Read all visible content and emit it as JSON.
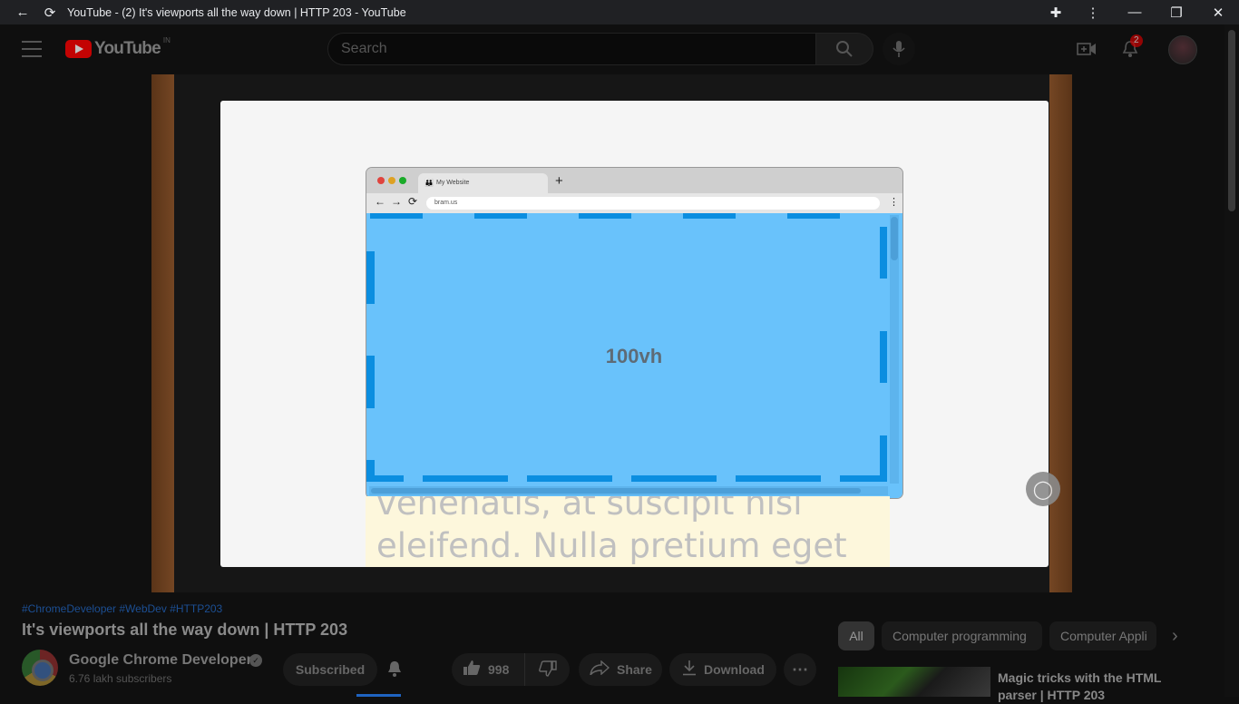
{
  "window": {
    "title": "YouTube - (2) It's viewports all the way down | HTTP 203 - YouTube",
    "back_icon": "←",
    "reload_icon": "⟳",
    "extensions_icon": "✚",
    "menu_icon": "⋮",
    "minimize_icon": "—",
    "restore_icon": "❐",
    "close_icon": "✕"
  },
  "header": {
    "logo_text": "YouTube",
    "logo_country": "IN",
    "search_placeholder": "Search",
    "search_icon": "⌕",
    "mic_icon": "🎙",
    "create_icon": "⊞",
    "notifications_count": "2",
    "bell_icon": "🔔"
  },
  "video": {
    "mock_browser": {
      "tab_label": "My Website",
      "tab_icon": "👪",
      "new_tab": "+",
      "back": "←",
      "forward": "→",
      "reload": "⟳",
      "url": "bram.us",
      "menu": "⋮",
      "viewport_label": "100vh"
    },
    "lorem_line_1": "venenatis, at suscipit nisi",
    "lorem_line_2": "eleifend. Nulla pretium eget",
    "chrome_badge": "◯"
  },
  "info": {
    "hashtags": "#ChromeDeveloper #WebDev #HTTP203",
    "title": "It's viewports all the way down | HTTP 203",
    "channel_name": "Google Chrome Developers",
    "verified_icon": "✓",
    "subscribers": "6.76 lakh subscribers",
    "subscribed_label": "Subscribed",
    "bell_icon": "🔔",
    "like_count": "998",
    "like_icon": "👍",
    "dislike_icon": "👎",
    "share_label": "Share",
    "share_icon": "➦",
    "download_label": "Download",
    "download_icon": "⤓",
    "more_icon": "⋯"
  },
  "chips": {
    "items": [
      "All",
      "Computer programming",
      "Computer Appli"
    ],
    "next_icon": "›"
  },
  "recommendation": {
    "title": "Magic tricks with the HTML parser | HTTP 203"
  }
}
